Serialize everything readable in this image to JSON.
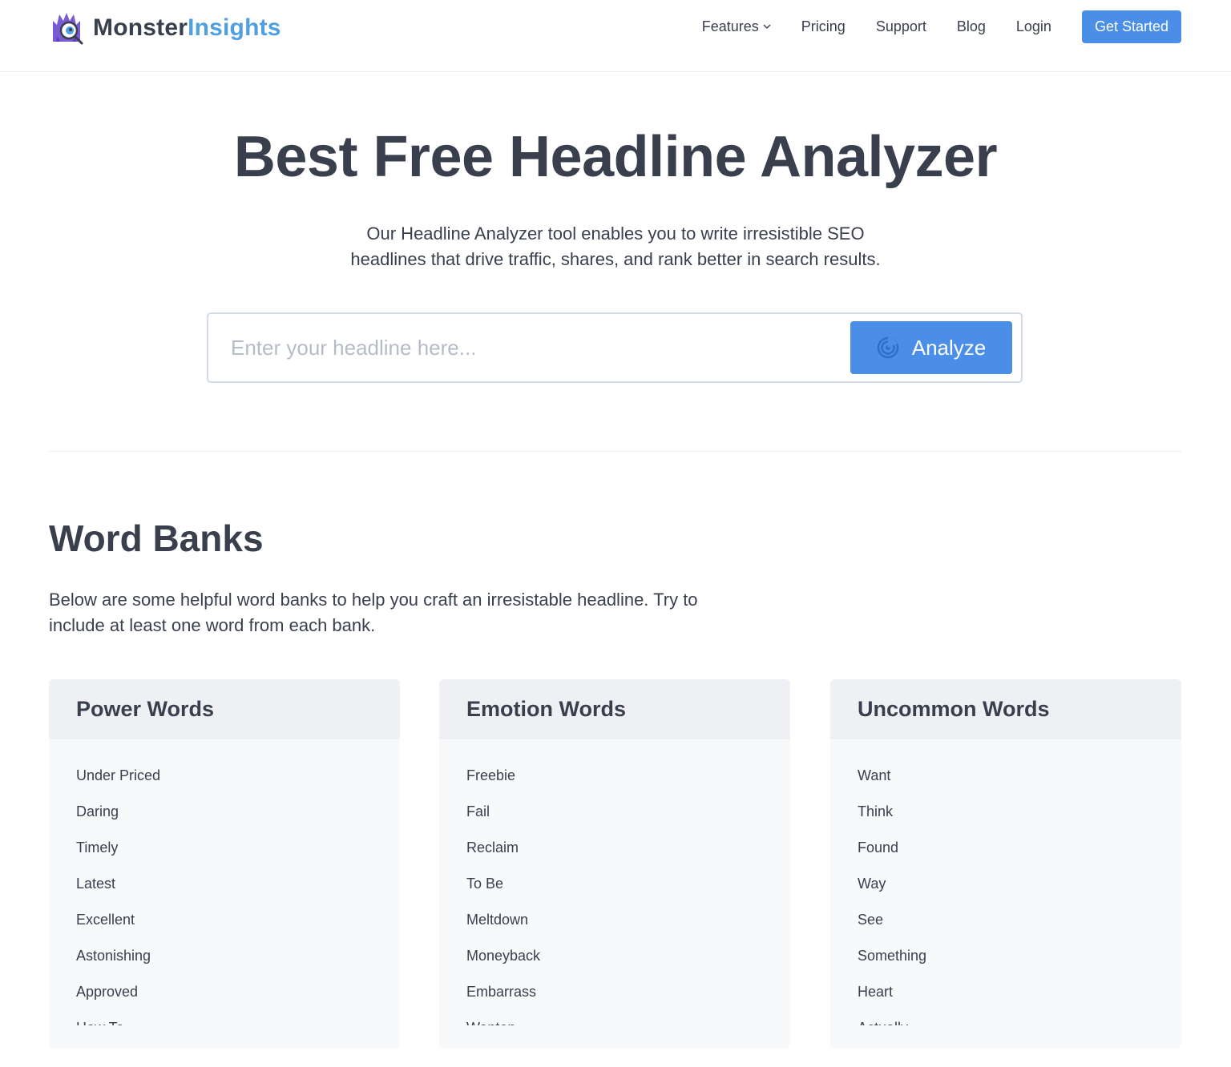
{
  "header": {
    "logo": {
      "part1": "Monster",
      "part2": "Insights"
    },
    "nav": [
      {
        "label": "Features",
        "dropdown": true
      },
      {
        "label": "Pricing"
      },
      {
        "label": "Support"
      },
      {
        "label": "Blog"
      },
      {
        "label": "Login"
      }
    ],
    "cta_label": "Get Started"
  },
  "hero": {
    "title": "Best Free Headline Analyzer",
    "subtitle_line1": "Our Headline Analyzer tool enables you to write irresistible SEO",
    "subtitle_line2": "headlines that drive traffic, shares, and rank better in search results.",
    "input_placeholder": "Enter your headline here...",
    "analyze_label": "Analyze"
  },
  "word_banks": {
    "title": "Word Banks",
    "description_line1": "Below are some helpful word banks to help you craft an irresistable headline. Try to",
    "description_line2": "include at least one word from each bank.",
    "banks": [
      {
        "title": "Power Words",
        "words": [
          "Under Priced",
          "Daring",
          "Timely",
          "Latest",
          "Excellent",
          "Astonishing",
          "Approved",
          "How To"
        ]
      },
      {
        "title": "Emotion Words",
        "words": [
          "Freebie",
          "Fail",
          "Reclaim",
          "To Be",
          "Meltdown",
          "Moneyback",
          "Embarrass",
          "Wanton"
        ]
      },
      {
        "title": "Uncommon Words",
        "words": [
          "Want",
          "Think",
          "Found",
          "Way",
          "See",
          "Something",
          "Heart",
          "Actually"
        ]
      }
    ]
  },
  "colors": {
    "primary": "#4a8ee8",
    "text": "#393f4c",
    "logo_accent": "#509fe2",
    "card_bg": "#f8f9fb",
    "card_head_bg": "#eef0f3"
  },
  "icons": {
    "logo": "monster-logo-icon",
    "dropdown": "chevron-down-icon",
    "analyze": "radar-icon"
  }
}
